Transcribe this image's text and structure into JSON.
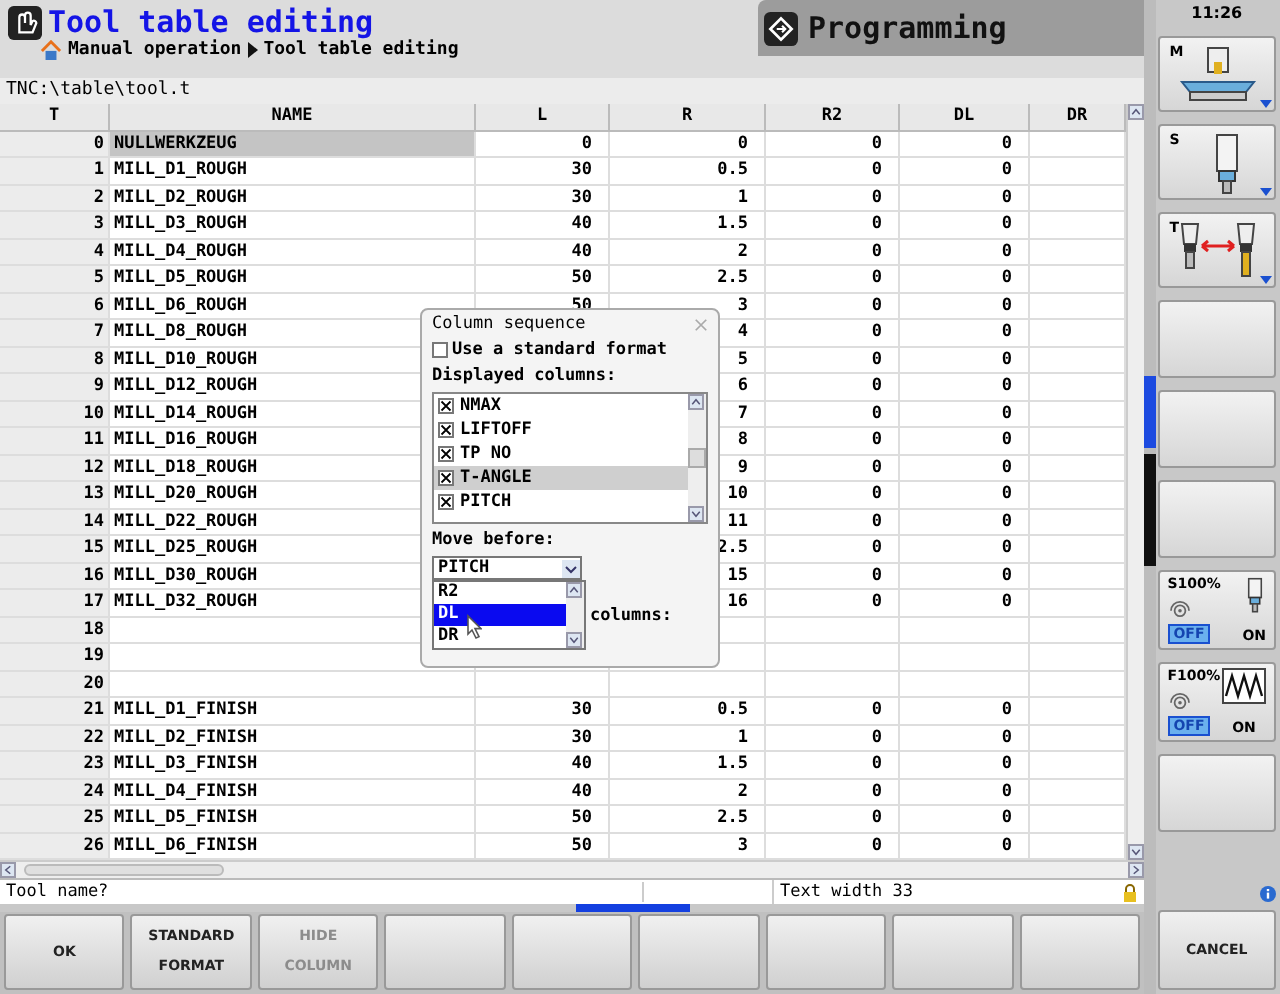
{
  "header": {
    "title": "Tool table editing",
    "breadcrumb": [
      "Manual operation",
      "Tool table editing"
    ],
    "mode": "Programming"
  },
  "clock": "11:26",
  "path": "TNC:\\table\\tool.t",
  "table": {
    "columns": [
      "T",
      "NAME",
      "L",
      "R",
      "R2",
      "DL",
      "DR"
    ],
    "rows": [
      {
        "t": "0",
        "name": "NULLWERKZEUG",
        "l": "0",
        "r": "0",
        "r2": "0",
        "dl": "0",
        "selected": true
      },
      {
        "t": "1",
        "name": "MILL_D1_ROUGH",
        "l": "30",
        "r": "0.5",
        "r2": "0",
        "dl": "0",
        "selected": false
      },
      {
        "t": "2",
        "name": "MILL_D2_ROUGH",
        "l": "30",
        "r": "1",
        "r2": "0",
        "dl": "0",
        "selected": false
      },
      {
        "t": "3",
        "name": "MILL_D3_ROUGH",
        "l": "40",
        "r": "1.5",
        "r2": "0",
        "dl": "0",
        "selected": false
      },
      {
        "t": "4",
        "name": "MILL_D4_ROUGH",
        "l": "40",
        "r": "2",
        "r2": "0",
        "dl": "0",
        "selected": false
      },
      {
        "t": "5",
        "name": "MILL_D5_ROUGH",
        "l": "50",
        "r": "2.5",
        "r2": "0",
        "dl": "0",
        "selected": false
      },
      {
        "t": "6",
        "name": "MILL_D6_ROUGH",
        "l": "50",
        "r": "3",
        "r2": "0",
        "dl": "0",
        "selected": false
      },
      {
        "t": "7",
        "name": "MILL_D8_ROUGH",
        "r": "4",
        "r2": "0",
        "dl": "0",
        "selected": false
      },
      {
        "t": "8",
        "name": "MILL_D10_ROUGH",
        "r": "5",
        "r2": "0",
        "dl": "0",
        "selected": false
      },
      {
        "t": "9",
        "name": "MILL_D12_ROUGH",
        "r": "6",
        "r2": "0",
        "dl": "0",
        "selected": false
      },
      {
        "t": "10",
        "name": "MILL_D14_ROUGH",
        "r": "7",
        "r2": "0",
        "dl": "0",
        "selected": false
      },
      {
        "t": "11",
        "name": "MILL_D16_ROUGH",
        "r": "8",
        "r2": "0",
        "dl": "0",
        "selected": false
      },
      {
        "t": "12",
        "name": "MILL_D18_ROUGH",
        "r": "9",
        "r2": "0",
        "dl": "0",
        "selected": false
      },
      {
        "t": "13",
        "name": "MILL_D20_ROUGH",
        "r": "10",
        "r2": "0",
        "dl": "0",
        "selected": false
      },
      {
        "t": "14",
        "name": "MILL_D22_ROUGH",
        "r": "11",
        "r2": "0",
        "dl": "0",
        "selected": false
      },
      {
        "t": "15",
        "name": "MILL_D25_ROUGH",
        "r": "2.5",
        "r2": "0",
        "dl": "0",
        "selected": false
      },
      {
        "t": "16",
        "name": "MILL_D30_ROUGH",
        "r": "15",
        "r2": "0",
        "dl": "0",
        "selected": false
      },
      {
        "t": "17",
        "name": "MILL_D32_ROUGH",
        "r": "16",
        "r2": "0",
        "dl": "0",
        "selected": false
      },
      {
        "t": "18",
        "selected": false
      },
      {
        "t": "19",
        "selected": false
      },
      {
        "t": "20",
        "selected": false
      },
      {
        "t": "21",
        "name": "MILL_D1_FINISH",
        "l": "30",
        "r": "0.5",
        "r2": "0",
        "dl": "0",
        "selected": false
      },
      {
        "t": "22",
        "name": "MILL_D2_FINISH",
        "l": "30",
        "r": "1",
        "r2": "0",
        "dl": "0",
        "selected": false
      },
      {
        "t": "23",
        "name": "MILL_D3_FINISH",
        "l": "40",
        "r": "1.5",
        "r2": "0",
        "dl": "0",
        "selected": false
      },
      {
        "t": "24",
        "name": "MILL_D4_FINISH",
        "l": "40",
        "r": "2",
        "r2": "0",
        "dl": "0",
        "selected": false
      },
      {
        "t": "25",
        "name": "MILL_D5_FINISH",
        "l": "50",
        "r": "2.5",
        "r2": "0",
        "dl": "0",
        "selected": false
      },
      {
        "t": "26",
        "name": "MILL_D6_FINISH",
        "l": "50",
        "r": "3",
        "r2": "0",
        "dl": "0",
        "selected": false
      }
    ]
  },
  "dialog": {
    "title": "Column sequence",
    "standard_format": {
      "label": "Use a standard format",
      "checked": false
    },
    "displayed_label": "Displayed columns:",
    "columns": [
      {
        "label": "NMAX",
        "checked": true,
        "selected": false
      },
      {
        "label": "LIFTOFF",
        "checked": true,
        "selected": false
      },
      {
        "label": "TP NO",
        "checked": true,
        "selected": false
      },
      {
        "label": "T-ANGLE",
        "checked": true,
        "selected": true
      },
      {
        "label": "PITCH",
        "checked": true,
        "selected": false
      }
    ],
    "move_label": "Move before:",
    "move_value": "PITCH",
    "move_options": [
      {
        "label": "R2",
        "selected": false
      },
      {
        "label": "DL",
        "selected": true
      },
      {
        "label": "DR",
        "selected": false
      }
    ],
    "fixed_label": "columns:"
  },
  "status": {
    "prompt": "Tool name?",
    "info": "Text width 33"
  },
  "side_keys": [
    {
      "kind": "machine",
      "label": "M"
    },
    {
      "kind": "spindle",
      "label": "S"
    },
    {
      "kind": "tool",
      "label": "T"
    },
    {
      "kind": "blank"
    },
    {
      "kind": "blank"
    },
    {
      "kind": "blank"
    },
    {
      "kind": "spindle-override",
      "label": "S100%",
      "off": "OFF",
      "on": "ON",
      "off_active": true
    },
    {
      "kind": "feed-override",
      "label": "F100%",
      "off": "OFF",
      "on": "ON",
      "off_active": true
    },
    {
      "kind": "blank"
    }
  ],
  "softkeys": [
    {
      "kind": "labeled",
      "label": "OK",
      "disabled": false
    },
    {
      "kind": "labeled",
      "label": "STANDARD FORMAT",
      "disabled": false
    },
    {
      "kind": "labeled",
      "label": "HIDE COLUMN",
      "disabled": true
    },
    {
      "kind": "blank"
    },
    {
      "kind": "blank"
    },
    {
      "kind": "blank"
    },
    {
      "kind": "blank"
    },
    {
      "kind": "blank"
    },
    {
      "kind": "blank"
    }
  ],
  "cancel_key": {
    "label": "CANCEL"
  }
}
